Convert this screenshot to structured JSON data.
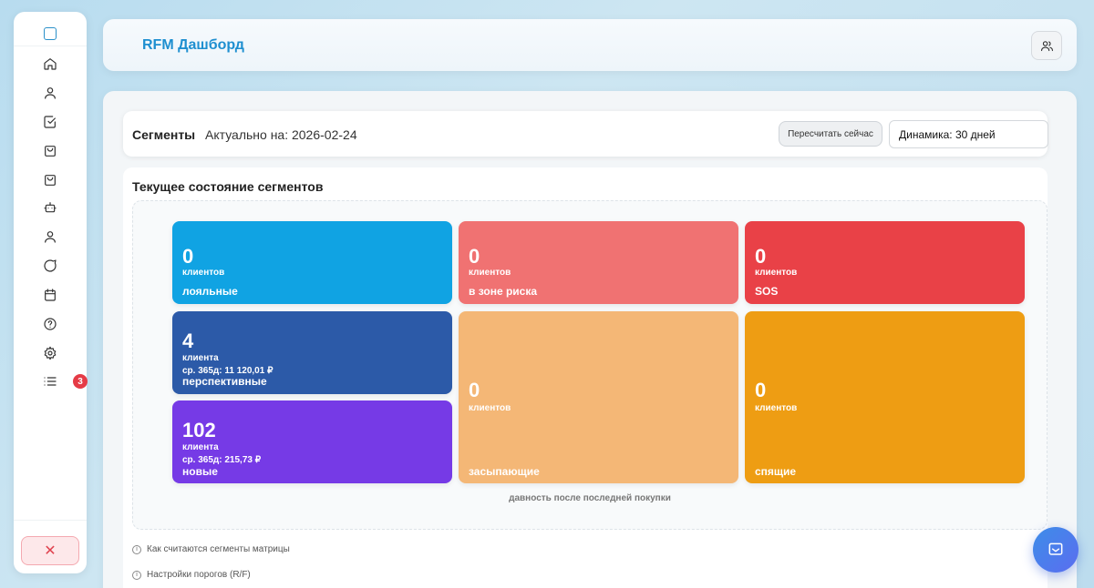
{
  "sidebar": {
    "items": [
      {
        "icon": "home-icon"
      },
      {
        "icon": "user-icon"
      },
      {
        "icon": "checkbox-icon"
      },
      {
        "icon": "shopping-bag-icon"
      },
      {
        "icon": "shopping-bag-icon"
      },
      {
        "icon": "robot-icon"
      },
      {
        "icon": "user-icon"
      },
      {
        "icon": "message-icon"
      },
      {
        "icon": "calendar-icon"
      },
      {
        "icon": "help-icon"
      },
      {
        "icon": "gear-icon"
      },
      {
        "icon": "list-icon",
        "badge": "3"
      }
    ],
    "close_label": "✕"
  },
  "header": {
    "title": "RFM Дашборд"
  },
  "segments_bar": {
    "title": "Сегменты",
    "date_text": "Актуально на: 2026-02-24",
    "recalc_label": "Пересчитать сейчас",
    "dynamics_value": "Динамика: 30 дней"
  },
  "matrix": {
    "title": "Текущее состояние сегментов",
    "axis_label": "давность после последней покупки",
    "tiles": {
      "loyal": {
        "count": "0",
        "unit": "клиентов",
        "name": "лояльные",
        "color": "#10a3e3"
      },
      "at_risk": {
        "count": "0",
        "unit": "клиентов",
        "name": "в зоне риска",
        "color": "#f07272"
      },
      "sos": {
        "count": "0",
        "unit": "клиентов",
        "name": "SOS",
        "color": "#e94147"
      },
      "promising": {
        "count": "4",
        "unit": "клиента",
        "avg": "ср. 365д: 11 120,01 ₽",
        "name": "перспективные",
        "color": "#2c5aa8"
      },
      "new": {
        "count": "102",
        "unit": "клиента",
        "avg": "ср. 365д: 215,73 ₽",
        "name": "новые",
        "color": "#763ae6"
      },
      "falling_asleep": {
        "count": "0",
        "unit": "клиентов",
        "name": "засыпающие",
        "color": "#f4b776"
      },
      "sleeping": {
        "count": "0",
        "unit": "клиентов",
        "name": "спящие",
        "color": "#ee9d13"
      }
    }
  },
  "info": {
    "how_calculated": "Как считаются сегменты матрицы",
    "thresholds": "Настройки порогов (R/F)"
  }
}
